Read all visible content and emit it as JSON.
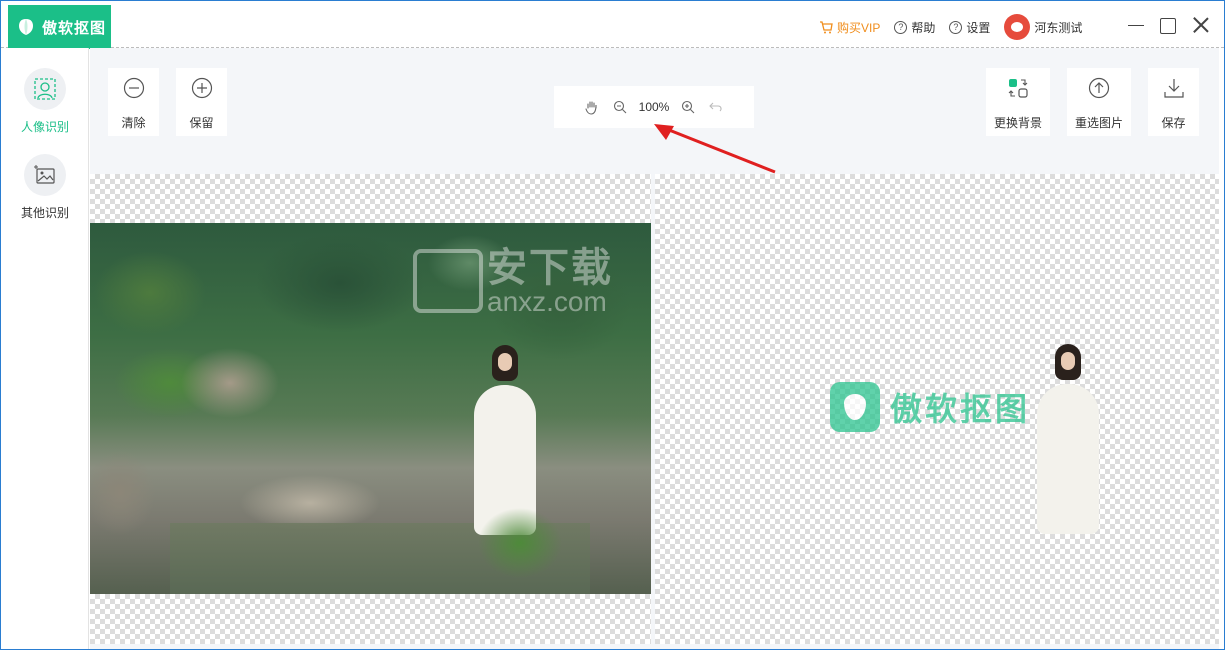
{
  "app": {
    "title": "傲软抠图"
  },
  "header": {
    "vip_label": "购买VIP",
    "help_label": "帮助",
    "settings_label": "设置",
    "username": "河东测试"
  },
  "sidebar": {
    "items": [
      {
        "label": "人像识别",
        "icon": "portrait-scan-icon",
        "active": true
      },
      {
        "label": "其他识别",
        "icon": "image-scan-icon",
        "active": false
      }
    ]
  },
  "toolbar": {
    "clear_label": "清除",
    "keep_label": "保留",
    "zoom_value": "100%",
    "change_bg_label": "更换背景",
    "reselect_label": "重选图片",
    "save_label": "保存"
  },
  "watermarks": {
    "left_cn": "安下载",
    "left_en": "anxz.com",
    "right_text": "傲软抠图"
  },
  "colors": {
    "brand": "#1bbf88",
    "vip": "#f08d1c",
    "arrow": "#e02020"
  }
}
